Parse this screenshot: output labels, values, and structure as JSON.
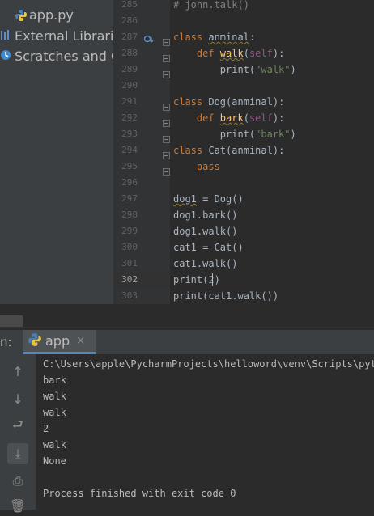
{
  "project_tree": {
    "items": [
      {
        "label": "app.py",
        "icon": "python-file-icon"
      },
      {
        "label": "External Libraries",
        "icon": "library-icon"
      },
      {
        "label": "Scratches and Consoles",
        "icon": "scratches-icon"
      }
    ]
  },
  "editor": {
    "line_numbers": [
      "285",
      "286",
      "287",
      "288",
      "289",
      "290",
      "291",
      "292",
      "293",
      "294",
      "295",
      "296",
      "297",
      "298",
      "299",
      "300",
      "301",
      "302",
      "303"
    ],
    "current_line": "302",
    "lines": [
      {
        "segments": [
          {
            "t": "# john.talk()",
            "c": "cmt"
          }
        ]
      },
      {
        "segments": []
      },
      {
        "segments": [
          {
            "t": "class ",
            "c": "kw"
          },
          {
            "t": "anminal",
            "c": "wavy"
          },
          {
            "t": ":",
            "c": ""
          }
        ]
      },
      {
        "segments": [
          {
            "t": "    def ",
            "c": "kw"
          },
          {
            "t": "walk",
            "c": "fn wavy"
          },
          {
            "t": "(",
            "c": ""
          },
          {
            "t": "self",
            "c": "selfp"
          },
          {
            "t": "):",
            "c": ""
          }
        ]
      },
      {
        "segments": [
          {
            "t": "        print(",
            "c": ""
          },
          {
            "t": "\"walk\"",
            "c": "str"
          },
          {
            "t": ")",
            "c": ""
          }
        ]
      },
      {
        "segments": []
      },
      {
        "segments": [
          {
            "t": "class ",
            "c": "kw"
          },
          {
            "t": "Dog",
            "c": ""
          },
          {
            "t": "(anminal):",
            "c": ""
          }
        ]
      },
      {
        "segments": [
          {
            "t": "    def ",
            "c": "kw"
          },
          {
            "t": "bark",
            "c": "fn wavy"
          },
          {
            "t": "(",
            "c": ""
          },
          {
            "t": "self",
            "c": "selfp"
          },
          {
            "t": "):",
            "c": ""
          }
        ]
      },
      {
        "segments": [
          {
            "t": "        print(",
            "c": ""
          },
          {
            "t": "\"bark\"",
            "c": "str"
          },
          {
            "t": ")",
            "c": ""
          }
        ]
      },
      {
        "segments": [
          {
            "t": "class ",
            "c": "kw"
          },
          {
            "t": "Cat",
            "c": ""
          },
          {
            "t": "(anminal):",
            "c": ""
          }
        ]
      },
      {
        "segments": [
          {
            "t": "    pass",
            "c": "kw"
          }
        ]
      },
      {
        "segments": []
      },
      {
        "segments": [
          {
            "t": "dog1",
            "c": "wavy"
          },
          {
            "t": " = Dog()",
            "c": ""
          }
        ]
      },
      {
        "segments": [
          {
            "t": "dog1.bark()",
            "c": ""
          }
        ]
      },
      {
        "segments": [
          {
            "t": "dog1.walk()",
            "c": ""
          }
        ]
      },
      {
        "segments": [
          {
            "t": "cat1 = Cat()",
            "c": ""
          }
        ]
      },
      {
        "segments": [
          {
            "t": "cat1.walk()",
            "c": ""
          }
        ]
      },
      {
        "segments": [
          {
            "t": "print(",
            "c": ""
          },
          {
            "t": "2",
            "c": "num"
          },
          {
            "t": ")",
            "c": ""
          }
        ]
      },
      {
        "segments": [
          {
            "t": "print(cat1.walk())",
            "c": ""
          }
        ]
      }
    ]
  },
  "run_panel": {
    "label": "n:",
    "tab_name": "app",
    "tab_close": "×",
    "tools": [
      {
        "icon": "arrow-up-icon",
        "glyph": "↑"
      },
      {
        "icon": "arrow-down-icon",
        "glyph": "↓"
      },
      {
        "icon": "soft-wrap-icon",
        "glyph": "⮐"
      },
      {
        "icon": "scroll-to-end-icon",
        "glyph": "⤓"
      },
      {
        "icon": "print-icon",
        "glyph": "⎙"
      },
      {
        "icon": "trash-icon",
        "glyph": "🗑"
      }
    ],
    "output": [
      "C:\\Users\\apple\\PycharmProjects\\helloword\\venv\\Scripts\\python.exe",
      "bark",
      "walk",
      "walk",
      "2",
      "walk",
      "None",
      "",
      "Process finished with exit code 0"
    ]
  }
}
